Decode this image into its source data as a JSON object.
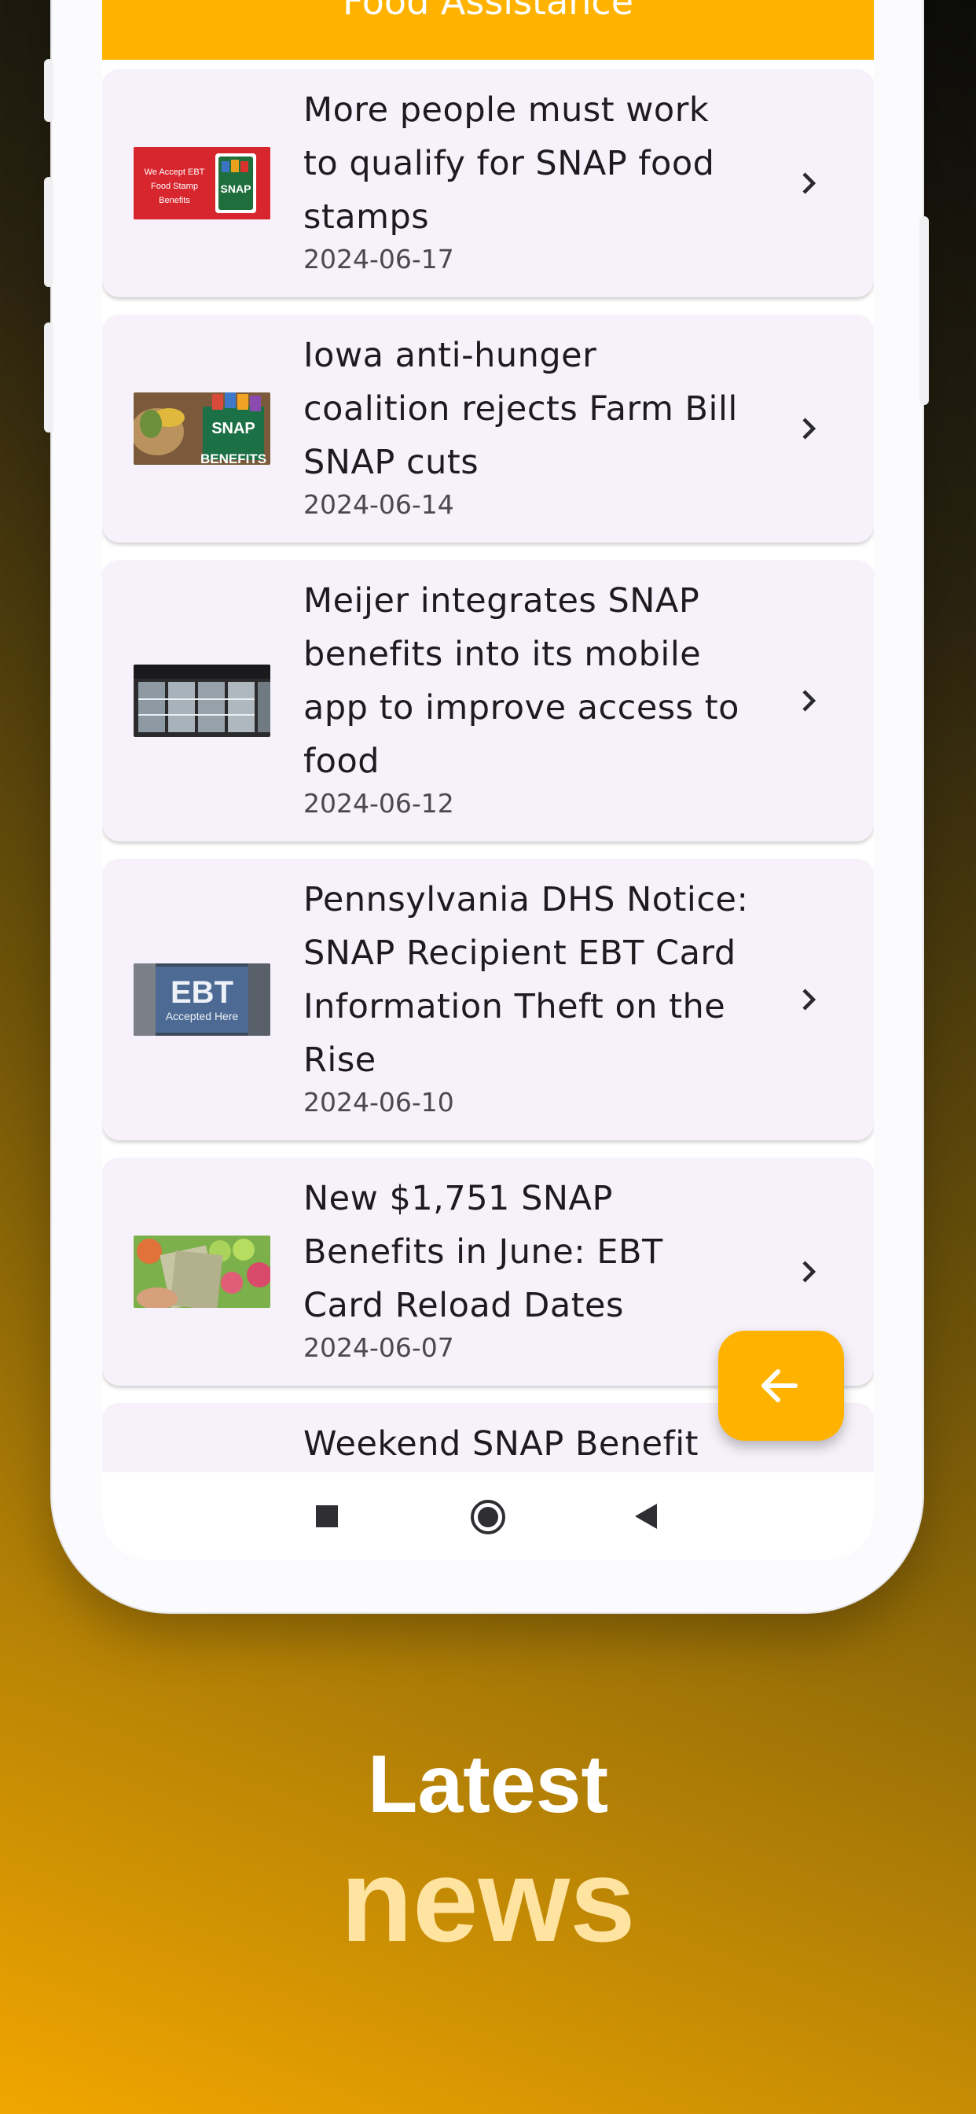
{
  "header": {
    "title": "Food Assistance"
  },
  "colors": {
    "accent": "#ffb300",
    "card": "#f6f1fa",
    "caption_light": "#ffe3a0"
  },
  "articles": [
    {
      "title": "More people must work to qualify for SNAP food stamps",
      "date": "2024-06-17",
      "thumb_text": [
        "We Accept EBT",
        "Food Stamp",
        "Benefits",
        "SNAP"
      ]
    },
    {
      "title": "Iowa anti-hunger coalition rejects Farm Bill SNAP cuts",
      "date": "2024-06-14",
      "thumb_text": [
        "SNAP",
        "BENEFITS"
      ]
    },
    {
      "title": "Meijer integrates SNAP benefits into its mobile app to improve access to food",
      "date": "2024-06-12"
    },
    {
      "title": "Pennsylvania DHS Notice: SNAP Recipient EBT Card Information Theft on the Rise",
      "date": "2024-06-10",
      "thumb_text": [
        "EBT",
        "Accepted Here"
      ]
    },
    {
      "title": "New $1,751 SNAP Benefits in June: EBT Card Reload Dates",
      "date": "2024-06-07"
    },
    {
      "title": "Weekend SNAP Benefit"
    }
  ],
  "fab": {
    "icon": "arrow-left-icon"
  },
  "nav": {
    "icons": [
      "recents-square-icon",
      "home-circle-icon",
      "back-triangle-icon"
    ]
  },
  "caption": {
    "line1": "Latest",
    "line2": "news"
  }
}
